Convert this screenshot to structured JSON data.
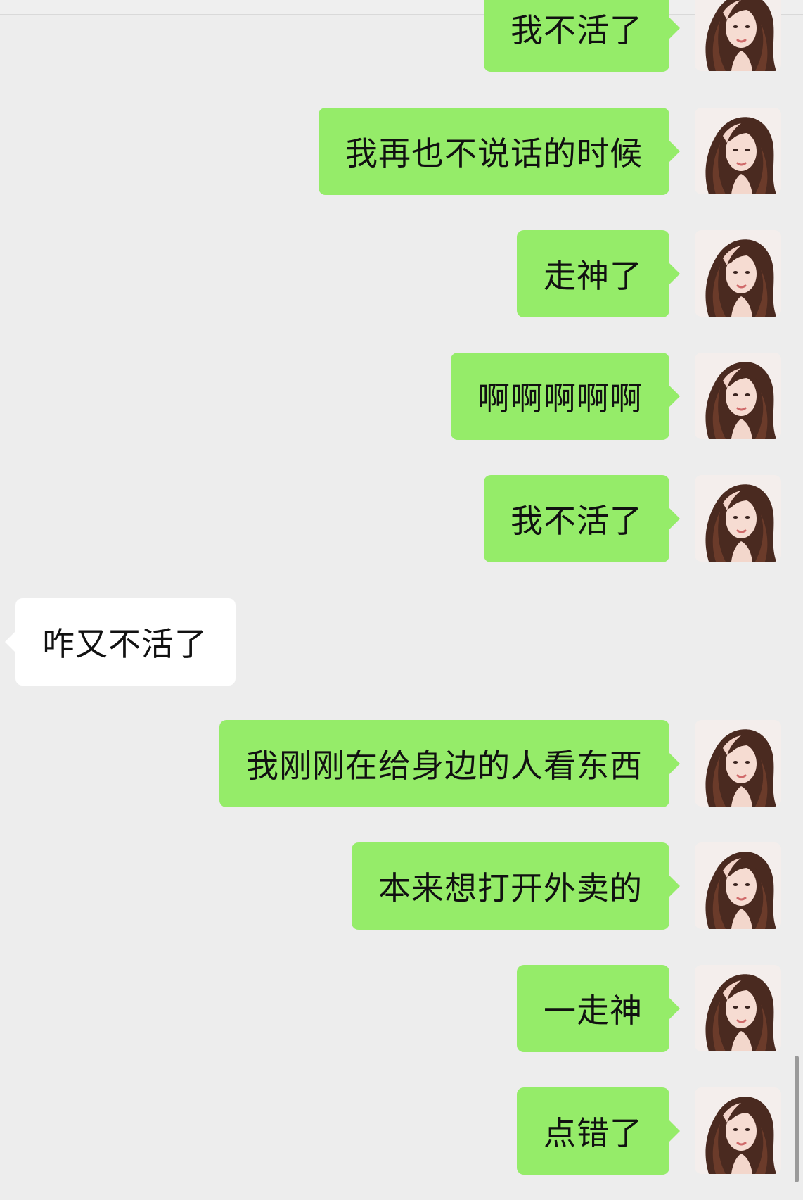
{
  "colors": {
    "background": "#ededed",
    "outgoing_bubble": "#95ec69",
    "incoming_bubble": "#ffffff",
    "text": "#111111"
  },
  "avatar_icon": "user-avatar-photo",
  "messages": [
    {
      "sender": "me",
      "text": "我不活了"
    },
    {
      "sender": "me",
      "text": "我再也不说话的时候"
    },
    {
      "sender": "me",
      "text": "走神了"
    },
    {
      "sender": "me",
      "text": "啊啊啊啊啊"
    },
    {
      "sender": "me",
      "text": "我不活了"
    },
    {
      "sender": "them",
      "text": "咋又不活了"
    },
    {
      "sender": "me",
      "text": "我刚刚在给身边的人看东西"
    },
    {
      "sender": "me",
      "text": "本来想打开外卖的"
    },
    {
      "sender": "me",
      "text": "一走神"
    },
    {
      "sender": "me",
      "text": "点错了"
    }
  ]
}
